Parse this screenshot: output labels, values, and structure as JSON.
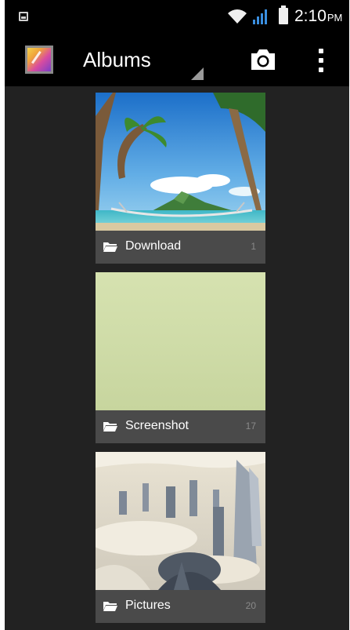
{
  "status_bar": {
    "time": "2:10",
    "ampm": "PM",
    "icons": [
      "image-notification-icon",
      "wifi-icon",
      "signal-icon",
      "battery-icon"
    ]
  },
  "action_bar": {
    "app_icon": "gallery-app-icon",
    "title": "Albums",
    "actions": [
      "camera-icon",
      "overflow-menu-icon"
    ]
  },
  "albums": [
    {
      "name": "Download",
      "count": "1",
      "thumbnail": "tropical-beach-hammock-photo"
    },
    {
      "name": "Screenshot",
      "count": "17",
      "thumbnail": "pale-green-screenshot"
    },
    {
      "name": "Pictures",
      "count": "20",
      "thumbnail": "city-above-clouds-photo"
    }
  ],
  "colors": {
    "background": "#222222",
    "bars": "#000000",
    "label_bar": "#4a4a4a"
  }
}
